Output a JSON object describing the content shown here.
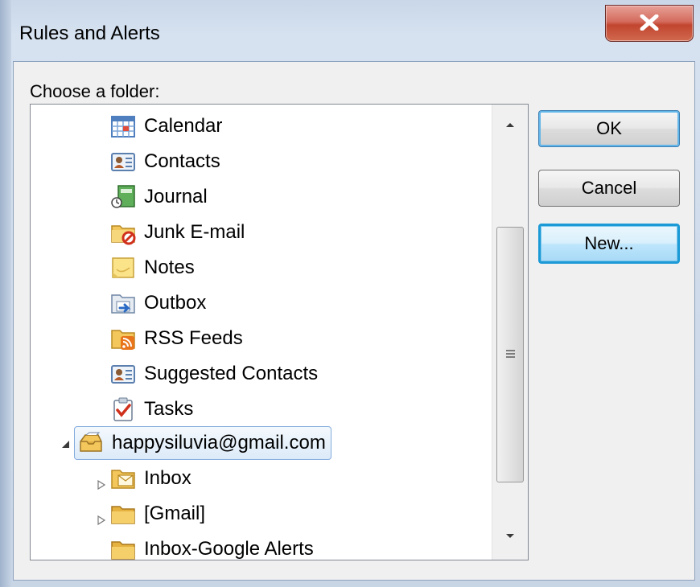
{
  "window": {
    "title": "Rules and Alerts"
  },
  "dialog": {
    "choose_label": "Choose a folder:",
    "buttons": {
      "ok": "OK",
      "cancel": "Cancel",
      "new": "New..."
    }
  },
  "folders": [
    {
      "label": "Calendar",
      "icon": "calendar-icon"
    },
    {
      "label": "Contacts",
      "icon": "contacts-icon"
    },
    {
      "label": "Journal",
      "icon": "journal-icon"
    },
    {
      "label": "Junk E-mail",
      "icon": "junk-email-folder-icon"
    },
    {
      "label": "Notes",
      "icon": "notes-icon"
    },
    {
      "label": "Outbox",
      "icon": "outbox-folder-icon"
    },
    {
      "label": "RSS Feeds",
      "icon": "rss-feeds-folder-icon"
    },
    {
      "label": "Suggested Contacts",
      "icon": "contacts-icon"
    },
    {
      "label": "Tasks",
      "icon": "tasks-icon"
    }
  ],
  "account": {
    "label": "happysiluvia@gmail.com",
    "icon": "mailbox-icon",
    "expanded": true,
    "selected": true
  },
  "account_folders": [
    {
      "label": "Inbox",
      "icon": "inbox-folder-icon",
      "expandable": true
    },
    {
      "label": "[Gmail]",
      "icon": "folder-icon",
      "expandable": true
    },
    {
      "label": "Inbox-Google Alerts",
      "icon": "folder-icon",
      "expandable": false
    }
  ],
  "colors": {
    "selection_border": "#84acdd",
    "focus_border": "#1c9ad6",
    "close_button": "#c2452f"
  }
}
